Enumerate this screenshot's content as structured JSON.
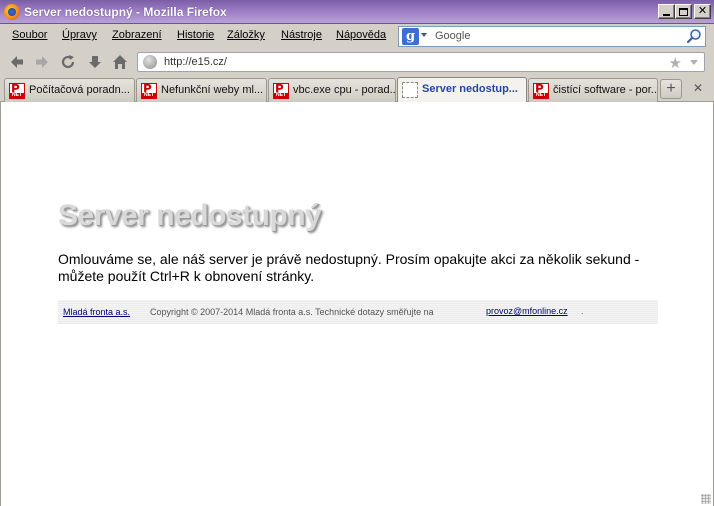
{
  "window": {
    "title": "Server nedostupný - Mozilla Firefox"
  },
  "menu": {
    "items": [
      {
        "label": "Soubor"
      },
      {
        "label": "Úpravy"
      },
      {
        "label": "Zobrazení"
      },
      {
        "label": "Historie"
      },
      {
        "label": "Záložky"
      },
      {
        "label": "Nástroje"
      },
      {
        "label": "Nápověda"
      }
    ]
  },
  "search": {
    "engine": "Google",
    "placeholder": "Google"
  },
  "address": {
    "url": "http://e15.cz/"
  },
  "tabs": [
    {
      "label": "Počítačová poradn...",
      "active": false
    },
    {
      "label": "Nefunkční weby ml...",
      "active": false
    },
    {
      "label": "vbc.exe cpu - porad...",
      "active": false
    },
    {
      "label": "Server nedostup...",
      "active": true
    },
    {
      "label": "čistící software - por...",
      "active": false
    }
  ],
  "page": {
    "heading": "Server nedostupný",
    "message": "Omlouváme se, ale náš server je právě nedostupný. Prosím opakujte akci za několik sekund - můžete použít Ctrl+R k obnovení stránky.",
    "footer": {
      "company_link": "Mladá fronta a.s.",
      "copyright": "Copyright © 2007-2014 Mladá fronta a.s. Technické dotazy směřujte na",
      "email": "provoz@mfonline.cz",
      "trailing": "."
    }
  },
  "colors": {
    "titlebar": "#9b7cc4",
    "active_tab_text": "#2646a5",
    "link": "#00007f"
  }
}
